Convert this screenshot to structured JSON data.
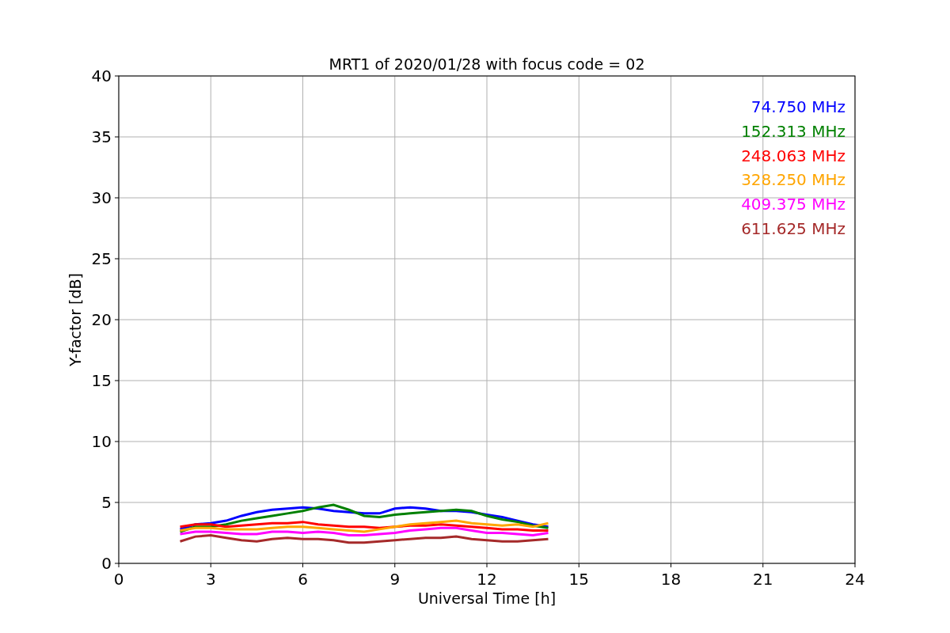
{
  "figure": {
    "chart_data": {
      "type": "line",
      "title": "MRT1 of 2020/01/28 with focus code = 02",
      "xlabel": "Universal Time [h]",
      "ylabel": "Y-factor [dB]",
      "grid": true,
      "xlim": [
        0,
        24
      ],
      "ylim": [
        0,
        40
      ],
      "xticks": [
        0,
        3,
        6,
        9,
        12,
        15,
        18,
        21,
        24
      ],
      "yticks": [
        0,
        5,
        10,
        15,
        20,
        25,
        30,
        35,
        40
      ],
      "x": [
        2,
        2.5,
        3,
        3.5,
        4,
        4.5,
        5,
        5.5,
        6,
        6.5,
        7,
        7.5,
        8,
        8.5,
        9,
        9.5,
        10,
        10.5,
        11,
        11.5,
        12,
        12.5,
        13,
        13.5,
        14
      ],
      "series": [
        {
          "name": "74.750 MHz",
          "color": "#0000ff",
          "values": [
            2.8,
            3.2,
            3.3,
            3.5,
            3.9,
            4.2,
            4.4,
            4.5,
            4.6,
            4.5,
            4.3,
            4.2,
            4.1,
            4.1,
            4.5,
            4.6,
            4.5,
            4.3,
            4.3,
            4.2,
            4.0,
            3.8,
            3.5,
            3.2,
            3.0
          ]
        },
        {
          "name": "152.313 MHz",
          "color": "#008000",
          "values": [
            2.6,
            3.0,
            3.0,
            3.2,
            3.5,
            3.7,
            3.9,
            4.1,
            4.3,
            4.6,
            4.8,
            4.4,
            3.9,
            3.8,
            4.0,
            4.1,
            4.2,
            4.3,
            4.4,
            4.3,
            3.9,
            3.6,
            3.4,
            3.1,
            2.9
          ]
        },
        {
          "name": "248.063 MHz",
          "color": "#ff0000",
          "values": [
            3.0,
            3.2,
            3.2,
            3.0,
            3.1,
            3.2,
            3.3,
            3.3,
            3.4,
            3.2,
            3.1,
            3.0,
            3.0,
            2.9,
            3.0,
            3.1,
            3.1,
            3.2,
            3.1,
            3.0,
            2.9,
            2.8,
            2.8,
            2.7,
            2.7
          ]
        },
        {
          "name": "328.250 MHz",
          "color": "#ffa500",
          "values": [
            2.7,
            2.9,
            2.9,
            2.8,
            2.8,
            2.8,
            2.9,
            3.0,
            3.0,
            2.9,
            2.8,
            2.7,
            2.6,
            2.8,
            3.0,
            3.2,
            3.3,
            3.4,
            3.5,
            3.3,
            3.2,
            3.1,
            3.2,
            3.0,
            3.3
          ]
        },
        {
          "name": "409.375 MHz",
          "color": "#ff00ff",
          "values": [
            2.4,
            2.6,
            2.6,
            2.5,
            2.4,
            2.4,
            2.6,
            2.6,
            2.5,
            2.6,
            2.5,
            2.3,
            2.3,
            2.4,
            2.5,
            2.7,
            2.8,
            2.9,
            2.9,
            2.7,
            2.5,
            2.5,
            2.4,
            2.3,
            2.5
          ]
        },
        {
          "name": "611.625 MHz",
          "color": "#a52a2a",
          "values": [
            1.8,
            2.2,
            2.3,
            2.1,
            1.9,
            1.8,
            2.0,
            2.1,
            2.0,
            2.0,
            1.9,
            1.7,
            1.7,
            1.8,
            1.9,
            2.0,
            2.1,
            2.1,
            2.2,
            2.0,
            1.9,
            1.8,
            1.8,
            1.9,
            2.0
          ]
        }
      ]
    }
  }
}
